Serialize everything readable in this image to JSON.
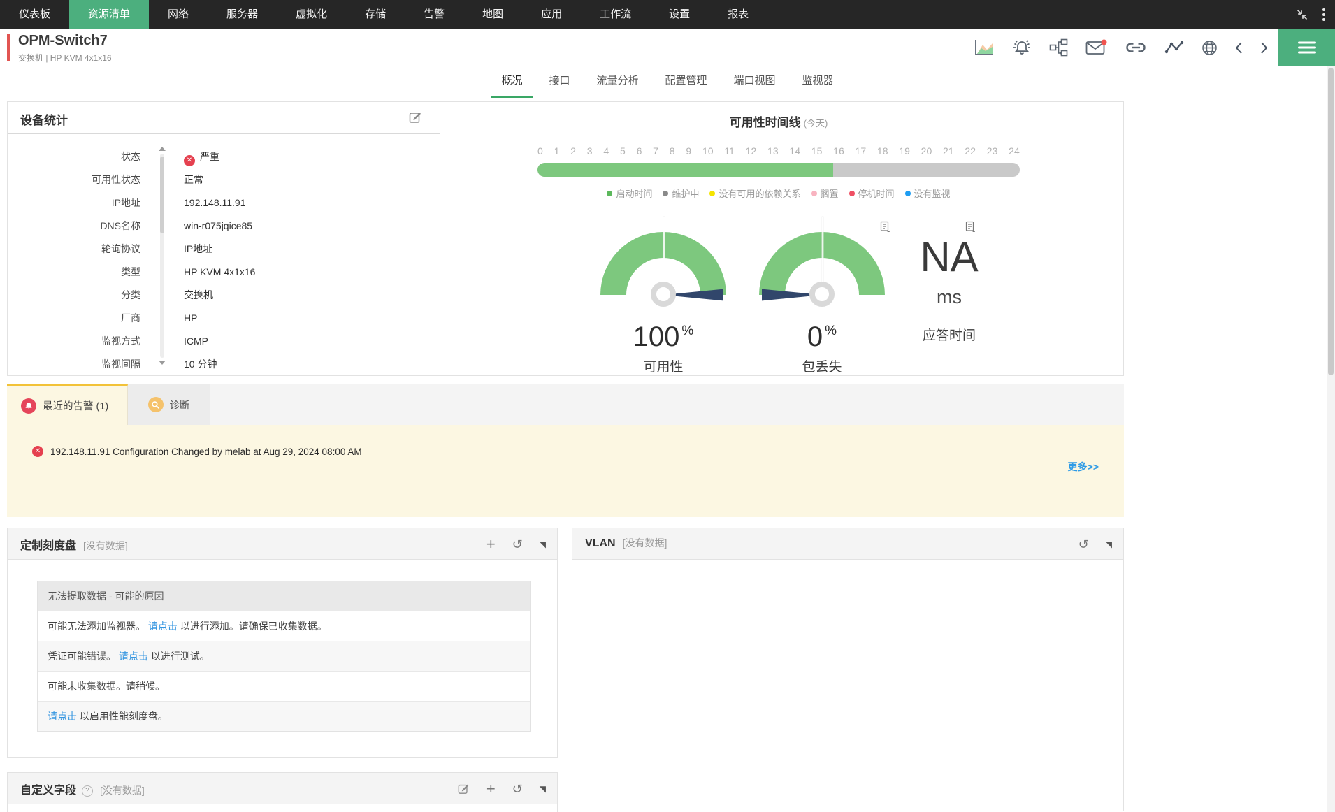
{
  "nav": {
    "active": "资源清单",
    "items": [
      {
        "label": "仪表板"
      },
      {
        "label": "资源清单"
      },
      {
        "label": "网络"
      },
      {
        "label": "服务器"
      },
      {
        "label": "虚拟化"
      },
      {
        "label": "存储"
      },
      {
        "label": "告警"
      },
      {
        "label": "地图"
      },
      {
        "label": "应用"
      },
      {
        "label": "工作流"
      },
      {
        "label": "设置"
      },
      {
        "label": "报表"
      }
    ]
  },
  "device_header": {
    "title": "OPM-Switch7",
    "subtitle": "交换机 | HP KVM 4x1x16",
    "action_icons": [
      "performance-chart-icon",
      "alarm-bell-icon",
      "dependency-icon",
      "email-icon",
      "link-icon",
      "monitor-graph-icon",
      "web-icon",
      "chevron-left-icon",
      "chevron-right-icon",
      "menu-icon"
    ]
  },
  "tabs": {
    "active": "概况",
    "items": [
      {
        "label": "概况"
      },
      {
        "label": "接口"
      },
      {
        "label": "流量分析"
      },
      {
        "label": "配置管理"
      },
      {
        "label": "端口视图"
      },
      {
        "label": "监视器"
      }
    ]
  },
  "device_stats": {
    "title": "设备统计",
    "rows": [
      {
        "label": "状态",
        "value": "严重"
      },
      {
        "label": "可用性状态",
        "value": "正常"
      },
      {
        "label": "IP地址",
        "value": "192.148.11.91"
      },
      {
        "label": "DNS名称",
        "value": "win-r075jqice85"
      },
      {
        "label": "轮询协议",
        "value": "IP地址"
      },
      {
        "label": "类型",
        "value": "HP KVM 4x1x16"
      },
      {
        "label": "分类",
        "value": "交换机"
      },
      {
        "label": "厂商",
        "value": "HP"
      },
      {
        "label": "监视方式",
        "value": "ICMP"
      },
      {
        "label": "监视间隔",
        "value": "10 分钟"
      }
    ]
  },
  "availability_timeline": {
    "title": "可用性时间线",
    "title_suffix": "(今天)",
    "hours": [
      "0",
      "1",
      "2",
      "3",
      "4",
      "5",
      "6",
      "7",
      "8",
      "9",
      "10",
      "11",
      "12",
      "13",
      "14",
      "15",
      "16",
      "17",
      "18",
      "19",
      "20",
      "21",
      "22",
      "23",
      "24"
    ],
    "uptime_hours": 14.7,
    "uptime_percent": 61.3,
    "legend": [
      {
        "label": "启动时间",
        "color": "#5cb85c"
      },
      {
        "label": "维护中",
        "color": "#8a8a8a"
      },
      {
        "label": "没有可用的依赖关系",
        "color": "#f5e400"
      },
      {
        "label": "搁置",
        "color": "#f8b3c0"
      },
      {
        "label": "停机时间",
        "color": "#ef5064"
      },
      {
        "label": "没有监视",
        "color": "#1e9df2"
      }
    ]
  },
  "gauges": {
    "availability": {
      "value": "100",
      "unit": "%",
      "label": "可用性",
      "needle": "right"
    },
    "packet_loss": {
      "value": "0",
      "unit": "%",
      "label": "包丢失",
      "needle": "left"
    },
    "response_time": {
      "value": "NA",
      "unit": "ms",
      "label": "应答时间"
    }
  },
  "alerts": {
    "alarm_tab_label": "最近的告警 (1)",
    "diagnostics_tab_label": "诊断",
    "items": [
      {
        "text": "192.148.11.91 Configuration Changed by melab at Aug 29, 2024 08:00 AM"
      }
    ],
    "more_label": "更多>>"
  },
  "custom_dial": {
    "title": "定制刻度盘",
    "no_data": "[没有数据]",
    "error_title": "无法提取数据 - 可能的原因",
    "rows": [
      {
        "pre": "可能无法添加监视器。 ",
        "link": "请点击",
        "post": " 以进行添加。请确保已收集数据。"
      },
      {
        "pre": "凭证可能错误。 ",
        "link": "请点击",
        "post": " 以进行测试。"
      },
      {
        "pre": "可能未收集数据。请稍候。",
        "link": "",
        "post": ""
      },
      {
        "pre": "",
        "link": "请点击",
        "post": " 以启用性能刻度盘。"
      }
    ]
  },
  "vlan": {
    "title": "VLAN",
    "no_data": "[没有数据]"
  },
  "custom_fields": {
    "title": "自定义字段",
    "no_data": "[没有数据]"
  },
  "colors": {
    "accent_green": "#4caf7e",
    "gauge_green": "#7dc87e",
    "needle_navy": "#31466b",
    "alert_panel_bg": "#fcf7e2",
    "link_blue": "#3596e0",
    "severity_red": "#e5404f",
    "header_red_bar": "#e25552",
    "alarm_tab_top_border": "#f2c238"
  }
}
